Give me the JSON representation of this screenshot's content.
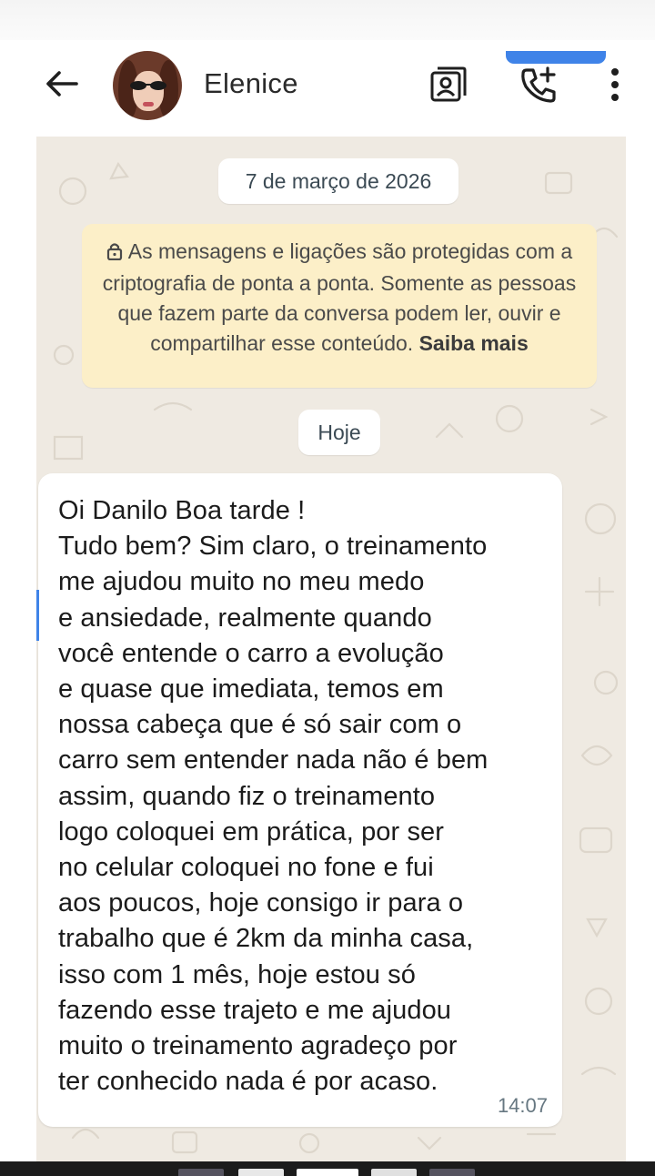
{
  "header": {
    "contact_name": "Elenice",
    "icons": [
      "back-arrow-icon",
      "contact-card-icon",
      "add-call-icon",
      "more-vertical-icon"
    ]
  },
  "chat": {
    "date_chip": "7 de março de 2026",
    "encryption_notice": {
      "text": "As mensagens e ligações são protegidas com a criptografia de ponta a ponta. Somente as pessoas que fazem parte da conversa podem ler, ouvir e compartilhar esse conteúdo.",
      "link": "Saiba mais"
    },
    "today_chip": "Hoje",
    "message": {
      "text": "Oi Danilo Boa tarde !\nTudo bem? Sim claro, o treinamento\nme ajudou muito no meu medo\ne ansiedade, realmente quando\nvocê entende o carro a evolução\ne quase que imediata, temos em\nnossa cabeça que é só sair com o\ncarro sem entender nada não é bem\nassim, quando fiz o treinamento\nlogo coloquei em prática, por ser\nno celular coloquei no fone e fui\naos poucos, hoje consigo ir para o\ntrabalho que é 2km da minha casa,\nisso com 1 mês, hoje estou só\nfazendo esse trajeto e me ajudou\nmuito o treinamento agradeço por\nter conhecido nada é por acaso.",
      "time": "14:07"
    }
  },
  "colors": {
    "chat_background": "#efeae2",
    "notice_background": "#fcefc8",
    "bubble_background": "#ffffff",
    "accent": "#3f83e8"
  }
}
